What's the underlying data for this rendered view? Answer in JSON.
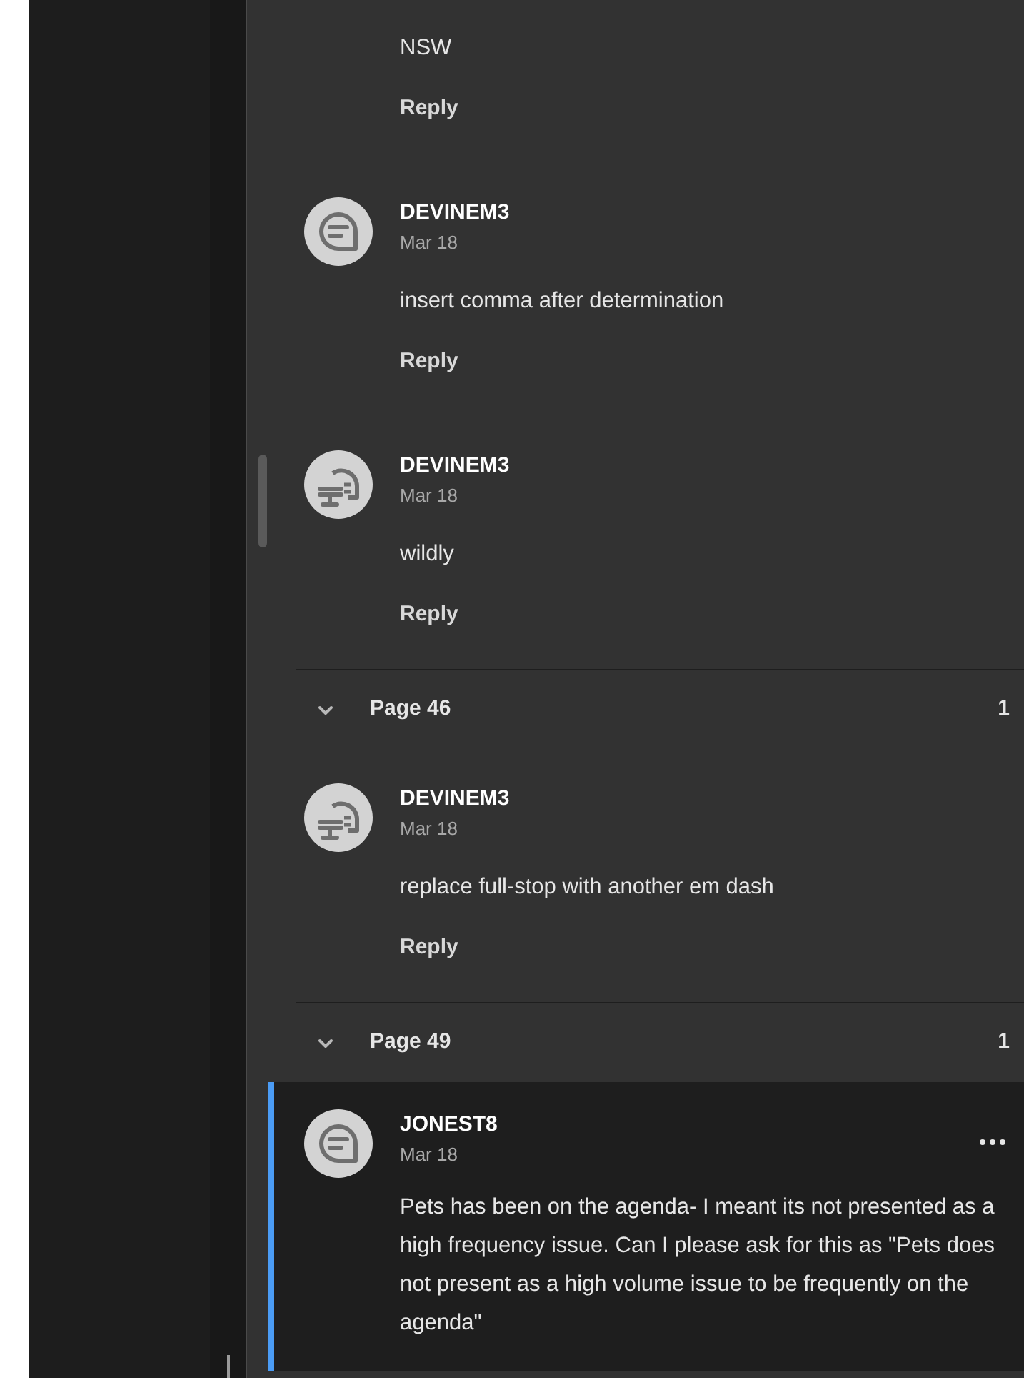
{
  "sections": [
    {
      "comments": [
        {
          "body": "NSW",
          "reply": "Reply",
          "selected": false
        },
        {
          "kind": "bubble",
          "author": "DEVINEM3",
          "date": "Mar 18",
          "body": "insert comma after determination",
          "reply": "Reply",
          "selected": false
        },
        {
          "kind": "stamp",
          "author": "DEVINEM3",
          "date": "Mar 18",
          "body": "wildly",
          "reply": "Reply",
          "selected": false
        }
      ]
    },
    {
      "title": "Page 46",
      "count": "1",
      "expanded": true,
      "comments": [
        {
          "kind": "stamp",
          "author": "DEVINEM3",
          "date": "Mar 18",
          "body": "replace full-stop with another em dash",
          "reply": "Reply",
          "selected": false
        }
      ]
    },
    {
      "title": "Page 49",
      "count": "1",
      "expanded": true,
      "comments": [
        {
          "kind": "bubble",
          "author": "JONEST8",
          "date": "Mar 18",
          "body": "Pets has been on the agenda- I meant its not presented as a high frequency issue. Can I please ask for this as \"Pets does not present as a high volume issue to be frequently on the agenda\"",
          "selected": true
        }
      ]
    }
  ]
}
